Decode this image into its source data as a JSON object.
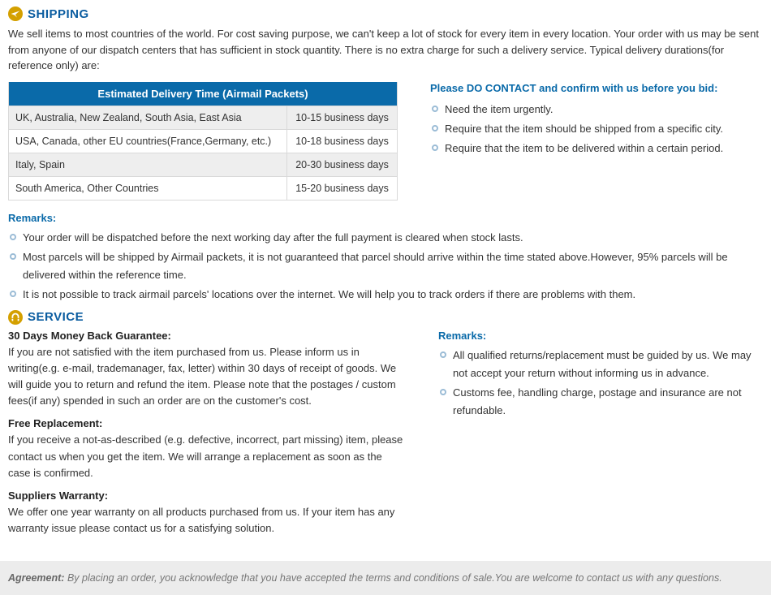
{
  "shipping": {
    "heading": "SHIPPING",
    "intro": "We sell items to most countries of the world. For cost saving purpose, we can't keep a lot of stock for every item in every location. Your order with us may be sent from anyone of our dispatch centers that has sufficient in stock quantity. There is no extra charge for such a delivery service. Typical delivery durations(for reference only) are:",
    "table": {
      "header": "Estimated Delivery Time (Airmail Packets)",
      "rows": [
        {
          "region": "UK, Australia, New Zealand, South Asia, East Asia",
          "time": "10-15 business days"
        },
        {
          "region": "USA, Canada, other EU countries(France,Germany, etc.)",
          "time": "10-18 business days"
        },
        {
          "region": "Italy, Spain",
          "time": "20-30 business days"
        },
        {
          "region": "South America, Other Countries",
          "time": "15-20 business days"
        }
      ]
    },
    "contact_head": "Please DO CONTACT and confirm with us before you bid:",
    "contact_items": [
      "Need the item urgently.",
      "Require that the item should be shipped from a specific city.",
      "Require that the item to be delivered within a certain period."
    ],
    "remarks_head": "Remarks:",
    "remarks": [
      "Your order will be dispatched before the next working day after the full payment is cleared when stock lasts.",
      "Most parcels will be shipped by Airmail packets, it is not guaranteed that parcel should arrive within the time stated above.However, 95% parcels will be delivered within the reference time.",
      "It is not possible to track airmail parcels' locations over the internet. We will help you to track orders if there are problems with them."
    ]
  },
  "service": {
    "heading": "SERVICE",
    "blocks": [
      {
        "title": "30 Days Money Back Guarantee:",
        "body": "If you are not satisfied with the item purchased from us. Please inform us in writing(e.g. e-mail, trademanager, fax, letter) within 30 days of receipt of goods. We will guide you to return and refund the item. Please note that the postages / custom fees(if any) spended in such an order are on the customer's cost."
      },
      {
        "title": "Free Replacement:",
        "body": "If you receive a not-as-described (e.g. defective, incorrect, part missing) item, please contact us when you get the item. We will arrange a replacement as soon as the case is confirmed."
      },
      {
        "title": "Suppliers Warranty:",
        "body": "We offer one year warranty on all products purchased from us. If your item has any warranty issue please contact us for a satisfying solution."
      }
    ],
    "remarks_head": "Remarks:",
    "remarks": [
      "All qualified returns/replacement must be guided by us. We may not accept your return without informing us in advance.",
      "Customs fee, handling charge, postage and insurance are not refundable."
    ]
  },
  "agreement": {
    "label": "Agreement:",
    "text": " By placing an order, you acknowledge that you have accepted the terms and conditions of sale.You are welcome to contact us with any questions."
  }
}
